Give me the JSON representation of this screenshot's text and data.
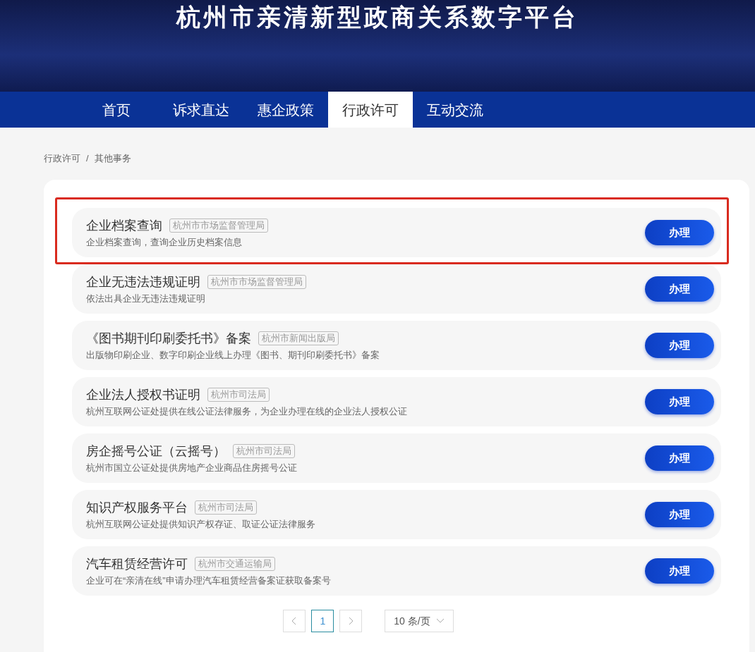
{
  "header": {
    "title": "杭州市亲清新型政商关系数字平台"
  },
  "nav": [
    {
      "label": "首页",
      "selected": false
    },
    {
      "label": "诉求直达",
      "selected": false
    },
    {
      "label": "惠企政策",
      "selected": false
    },
    {
      "label": "行政许可",
      "selected": true
    },
    {
      "label": "互动交流",
      "selected": false
    }
  ],
  "breadcrumb": {
    "items": [
      "行政许可",
      "其他事务"
    ],
    "separator": "/"
  },
  "items": [
    {
      "title": "企业档案查询",
      "agency": "杭州市市场监督管理局",
      "description": "企业档案查询，查询企业历史档案信息",
      "button": "办理",
      "highlighted": true
    },
    {
      "title": "企业无违法违规证明",
      "agency": "杭州市市场监督管理局",
      "description": "依法出具企业无违法违规证明",
      "button": "办理",
      "highlighted": false
    },
    {
      "title": "《图书期刊印刷委托书》备案",
      "agency": "杭州市新闻出版局",
      "description": "出版物印刷企业、数字印刷企业线上办理《图书、期刊印刷委托书》备案",
      "button": "办理",
      "highlighted": false
    },
    {
      "title": "企业法人授权书证明",
      "agency": "杭州市司法局",
      "description": "杭州互联网公证处提供在线公证法律服务，为企业办理在线的企业法人授权公证",
      "button": "办理",
      "highlighted": false
    },
    {
      "title": "房企摇号公证（云摇号）",
      "agency": "杭州市司法局",
      "description": "杭州市国立公证处提供房地产企业商品住房摇号公证",
      "button": "办理",
      "highlighted": false
    },
    {
      "title": "知识产权服务平台",
      "agency": "杭州市司法局",
      "description": "杭州互联网公证处提供知识产权存证、取证公证法律服务",
      "button": "办理",
      "highlighted": false
    },
    {
      "title": "汽车租赁经营许可",
      "agency": "杭州市交通运输局",
      "description": "企业可在“亲清在线”申请办理汽车租赁经营备案证获取备案号",
      "button": "办理",
      "highlighted": false
    }
  ],
  "pagination": {
    "pages": [
      {
        "label": "1",
        "selected": true
      }
    ],
    "page_size": "10 条/页"
  }
}
